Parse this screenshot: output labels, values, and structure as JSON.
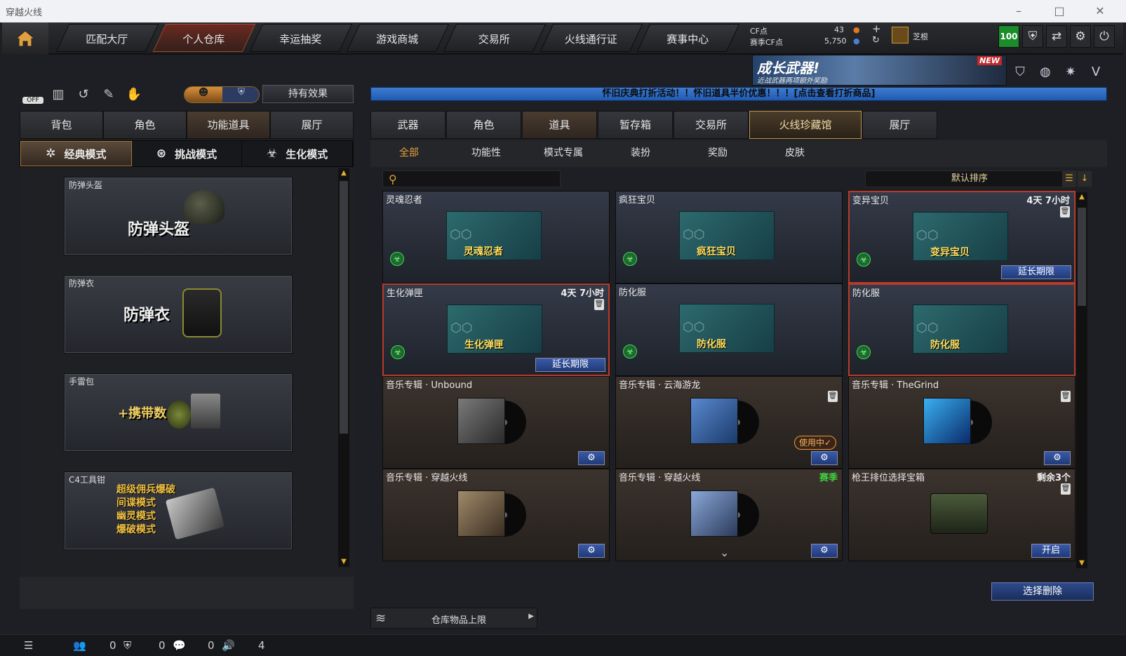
{
  "window": {
    "title": "穿越火线"
  },
  "nav": {
    "tabs": [
      "匹配大厅",
      "个人仓库",
      "幸运抽奖",
      "游戏商城",
      "交易所",
      "火线通行证",
      "赛事中心"
    ],
    "active": "个人仓库"
  },
  "resources": {
    "cf_label": "CF点",
    "cf_value": "43",
    "event_label": "赛季CF点",
    "event_value": "5,750"
  },
  "player": {
    "name": "芝根",
    "level": "100"
  },
  "banner": {
    "title": "成长武器!",
    "subtitle": "近战武器两项额外奖励",
    "badge": "NEW"
  },
  "marquee": "怀旧庆典打折活动！！怀旧道具半价优惠！！！[点击查看打折商品]",
  "left": {
    "toggle_off": "OFF",
    "effects_button": "持有效果",
    "tabs": [
      "背包",
      "角色",
      "功能道具",
      "展厅"
    ],
    "active_tab": "功能道具",
    "modes": [
      "经典模式",
      "挑战模式",
      "生化模式"
    ],
    "cards": [
      {
        "name": "防弹头盔",
        "art": "防弹头盔"
      },
      {
        "name": "防弹衣",
        "art": "防弹衣"
      },
      {
        "name": "手雷包",
        "art": "+携带数"
      },
      {
        "name": "C4工具钳",
        "art_lines": [
          "超级佣兵爆破",
          "间谍模式",
          "幽灵模式",
          "爆破模式"
        ]
      }
    ]
  },
  "right": {
    "tabs": [
      "武器",
      "角色",
      "道具",
      "暂存箱",
      "交易所",
      "火线珍藏馆",
      "展厅"
    ],
    "active_tab": "道具",
    "highlight_tab": "火线珍藏馆",
    "subtabs": [
      "全部",
      "功能性",
      "模式专属",
      "装扮",
      "奖励",
      "皮肤"
    ],
    "active_subtab": "全部",
    "search_placeholder": "",
    "sort_label": "默认排序",
    "items": [
      {
        "name": "灵魂忍者",
        "pic_label": "灵魂忍者",
        "kind": "bio"
      },
      {
        "name": "疯狂宝贝",
        "pic_label": "疯狂宝贝",
        "kind": "bio"
      },
      {
        "name": "变异宝贝",
        "pic_label": "变异宝贝",
        "kind": "bio",
        "time": "4天 7小时",
        "extend": "延长期限",
        "selected": true
      },
      {
        "name": "生化弹匣",
        "pic_label": "生化弹匣",
        "kind": "bio",
        "time": "4天 7小时",
        "extend": "延长期限",
        "selected": true
      },
      {
        "name": "防化服",
        "pic_label": "防化服",
        "kind": "bio"
      },
      {
        "name": "防化服",
        "pic_label": "防化服",
        "kind": "bio",
        "selected": true
      },
      {
        "name": "音乐专辑 · Unbound",
        "kind": "music"
      },
      {
        "name": "音乐专辑 · 云海游龙",
        "kind": "music",
        "in_use": "使用中✓"
      },
      {
        "name": "音乐专辑 · TheGrind",
        "kind": "music"
      },
      {
        "name": "音乐专辑 · 穿越火线",
        "kind": "music"
      },
      {
        "name": "音乐专辑 · 穿越火线",
        "kind": "music",
        "tag": "赛季"
      },
      {
        "name": "枪王排位选择宝箱",
        "kind": "box",
        "remain": "剩余3个",
        "open": "开启"
      }
    ],
    "delete_button": "选择删除",
    "capacity_label": "仓库物品上限"
  },
  "statusbar": {
    "friends": "0",
    "clan": "0",
    "chat": "0",
    "volume": "4"
  }
}
